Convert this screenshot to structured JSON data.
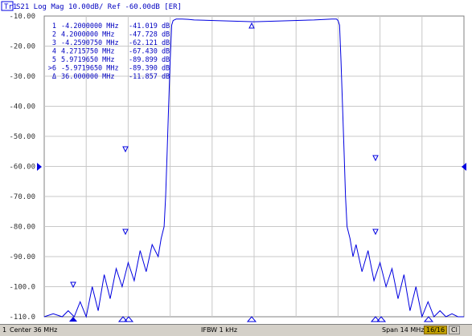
{
  "trace_header": {
    "trace_id": "Tr1",
    "text": "S21 Log Mag 10.00dB/ Ref -60.00dB [ER]"
  },
  "chart_data": {
    "type": "line",
    "title": "",
    "xlabel": "",
    "ylabel": "",
    "xlim": [
      29,
      43
    ],
    "ylim": [
      -110,
      -10
    ],
    "y_ticks": [
      "-10.00",
      "-20.00",
      "-30.00",
      "-40.00",
      "-50.00",
      "-60.00",
      "-70.00",
      "-80.00",
      "-90.00",
      "-100.0",
      "-110.0"
    ],
    "grid": true,
    "reference_level": -60,
    "series": [
      {
        "x": [
          29.0,
          29.3,
          29.6,
          29.8,
          30.0,
          30.2,
          30.4,
          30.6,
          30.8,
          31.0,
          31.2,
          31.4,
          31.6,
          31.8,
          32.0,
          32.2,
          32.4,
          32.6,
          32.8,
          32.9,
          33.0,
          33.05,
          33.1,
          33.15,
          33.2,
          33.25,
          33.3,
          33.4,
          33.6,
          33.8,
          34.0,
          35.0,
          36.0,
          37.0,
          38.0,
          38.4,
          38.6,
          38.75,
          38.8,
          38.85,
          38.9,
          38.95,
          39.0,
          39.05,
          39.1,
          39.2,
          39.3,
          39.4,
          39.6,
          39.8,
          40.0,
          40.2,
          40.4,
          40.6,
          40.8,
          41.0,
          41.2,
          41.4,
          41.6,
          41.8,
          42.0,
          42.2,
          42.4,
          42.6,
          42.8,
          43.0
        ],
        "y": [
          -110,
          -109,
          -110,
          -108,
          -110,
          -105,
          -110,
          -100,
          -108,
          -96,
          -104,
          -94,
          -100,
          -92,
          -98,
          -88,
          -95,
          -86,
          -90,
          -84,
          -80,
          -70,
          -55,
          -40,
          -25,
          -13,
          -11.5,
          -11.0,
          -11.0,
          -11.1,
          -11.3,
          -11.6,
          -11.9,
          -11.6,
          -11.3,
          -11.1,
          -11.0,
          -11.0,
          -11.5,
          -13,
          -25,
          -40,
          -55,
          -70,
          -80,
          -84,
          -90,
          -86,
          -95,
          -88,
          -98,
          -92,
          -100,
          -94,
          -104,
          -96,
          -108,
          -100,
          -110,
          -105,
          -110,
          -108,
          -110,
          -109,
          -110,
          -110
        ]
      }
    ]
  },
  "markers": [
    {
      "num": "1",
      "freq": "-4.2000000 MHz",
      "val": "-41.019 dB"
    },
    {
      "num": "2",
      "freq": "4.2000000 MHz",
      "val": "-47.728 dB"
    },
    {
      "num": "3",
      "freq": "-4.2590750 MHz",
      "val": "-62.121 dB"
    },
    {
      "num": "4",
      "freq": "4.2715750 MHz",
      "val": "-67.430 dB"
    },
    {
      "num": "5",
      "freq": "5.9719650 MHz",
      "val": "-89.899 dB"
    },
    {
      "num": ">6",
      "freq": "-5.9719650 MHz",
      "val": "-89.390 dB"
    },
    {
      "num": "Δ",
      "freq": "36.000000 MHz",
      "val": "-11.857 dB"
    }
  ],
  "status_bar": {
    "channel": "1",
    "center": "Center 36 MHz",
    "ifbw": "IFBW 1 kHz",
    "span": "Span 14 MHz",
    "points": "16/16",
    "cal": "Cl"
  },
  "colors": {
    "trace": "#0000e0",
    "grid": "#c8c8c8",
    "text": "#303030",
    "arrow": "#0000e0"
  }
}
